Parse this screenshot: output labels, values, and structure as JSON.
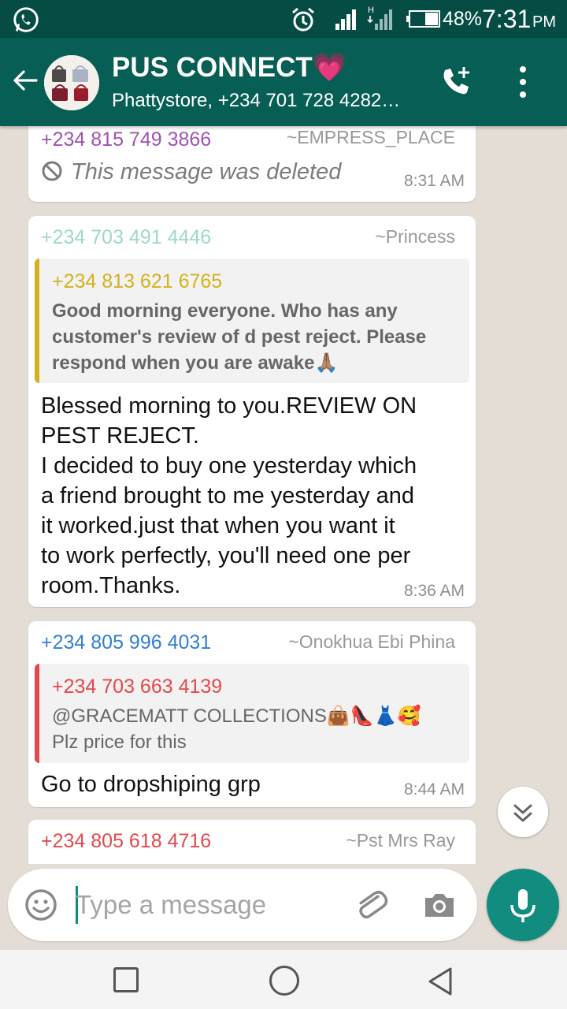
{
  "status_bar": {
    "battery_percent": "48%",
    "time": "7:31",
    "ampm": "PM",
    "network_label": "H"
  },
  "header": {
    "title": "PUS CONNECT",
    "title_emoji": "💗",
    "subtitle": "Phattystore, +234 701 728 4282…"
  },
  "messages": [
    {
      "sender": "+234 815 749 3866",
      "sender_color": "#a052b2",
      "pushname": "~EMPRESS_PLACE",
      "deleted_text": "This message was deleted",
      "time": "8:31 AM"
    },
    {
      "sender": "+234 703 491 4446",
      "sender_color": "#9fd8c8",
      "pushname": "~Princess",
      "quote": {
        "sender": "+234 813 621 6765",
        "color": "#d4b11b",
        "text": "Good morning everyone. Who has any customer's review of  d pest reject. Please respond when you are awake🙏🏽"
      },
      "body_lines": [
        "Blessed morning to you.REVIEW ON",
        "PEST REJECT.",
        "I decided to buy one yesterday which",
        "a friend brought to me yesterday and",
        "it worked.just that when you want it",
        "to work perfectly, you'll need one per",
        "room.Thanks."
      ],
      "time": "8:36 AM"
    },
    {
      "sender": "+234 805 996 4031",
      "sender_color": "#2f7fd6",
      "pushname": "~Onokhua Ebi Phina",
      "quote": {
        "sender": "+234 703 663 4139",
        "color": "#e5484d",
        "text_line1": "@GRACEMATT COLLECTIONS👜👠👗🥰",
        "text_line2": "Plz price for this"
      },
      "body": "Go to dropshiping grp",
      "time": "8:44 AM"
    },
    {
      "sender": "+234 805 618 4716",
      "sender_color": "#e5484d",
      "pushname": "~Pst Mrs Ray"
    }
  ],
  "composer": {
    "placeholder": "Type a message"
  },
  "colors": {
    "header": "#075e54",
    "statusbar": "#054d44",
    "accent": "#128c7e",
    "chat_bg": "#e4ddd6"
  },
  "icons": [
    "whatsapp-icon",
    "alarm-icon",
    "back-arrow-icon",
    "add-call-icon",
    "more-vert-icon",
    "deleted-icon",
    "scroll-down-icon",
    "emoji-icon",
    "attach-icon",
    "camera-icon",
    "mic-icon"
  ]
}
